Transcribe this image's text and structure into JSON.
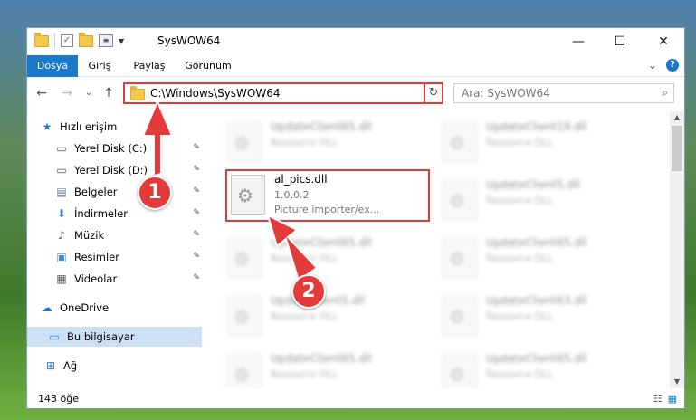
{
  "window": {
    "title": "SysWOW64",
    "controls": {
      "minimize": "—",
      "maximize": "☐",
      "close": "✕"
    }
  },
  "ribbon": {
    "tabs": [
      "Dosya",
      "Giriş",
      "Paylaş",
      "Görünüm"
    ],
    "expand_glyph": "⌄",
    "help_glyph": "?"
  },
  "nav": {
    "back": "←",
    "forward": "→",
    "recent": "⌄",
    "up": "↑",
    "address": "C:\\Windows\\SysWOW64",
    "address_chevron": "⌄",
    "refresh": "↻",
    "search_placeholder": "Ara: SysWOW64",
    "search_glyph": "⌕"
  },
  "sidebar": {
    "items": [
      {
        "label": "Hızlı erişim",
        "icon": "star-icon",
        "glyph": "★",
        "color": "#2a7fd4"
      },
      {
        "label": "Yerel Disk (C:)",
        "icon": "drive-icon",
        "glyph": "▭",
        "color": "#555"
      },
      {
        "label": "Yerel Disk (D:)",
        "icon": "drive-icon",
        "glyph": "▭",
        "color": "#555"
      },
      {
        "label": "Belgeler",
        "icon": "documents-icon",
        "glyph": "▤",
        "color": "#6a7b8c"
      },
      {
        "label": "İndirmeler",
        "icon": "download-icon",
        "glyph": "⬇",
        "color": "#2a7fd4"
      },
      {
        "label": "Müzik",
        "icon": "music-icon",
        "glyph": "♪",
        "color": "#2a7fd4"
      },
      {
        "label": "Resimler",
        "icon": "pictures-icon",
        "glyph": "▣",
        "color": "#4a8ac9"
      },
      {
        "label": "Videolar",
        "icon": "videos-icon",
        "glyph": "▦",
        "color": "#555"
      },
      {
        "label": "OneDrive",
        "icon": "cloud-icon",
        "glyph": "☁",
        "color": "#1979ca"
      },
      {
        "label": "Bu bilgisayar",
        "icon": "computer-icon",
        "glyph": "▭",
        "color": "#2a7fd4"
      },
      {
        "label": "Ağ",
        "icon": "network-icon",
        "glyph": "⊞",
        "color": "#2a7fd4"
      }
    ],
    "pin_glyph": "✎"
  },
  "files": {
    "highlighted": {
      "name": "al_pics.dll",
      "version": "1.0.0.2",
      "description": "Picture importer/ex..."
    },
    "blurred": [
      {
        "name": "UpdateClient65.dll",
        "desc": "Resource DLL"
      },
      {
        "name": "UpdateClient19.dll",
        "desc": "Resource DLL"
      },
      {
        "name": "UpdateClient5.dll",
        "desc": "Resource DLL"
      },
      {
        "name": "UpdateClient65.dll",
        "desc": "Resource DLL"
      },
      {
        "name": "UpdateClient65.dll",
        "desc": "Resource DLL"
      },
      {
        "name": "UpdateClient5.dll",
        "desc": "Resource DLL"
      },
      {
        "name": "UpdateClient63.dll",
        "desc": "Resource DLL"
      },
      {
        "name": "UpdateClient65.dll",
        "desc": "Resource DLL"
      },
      {
        "name": "UpdateClient65.dll",
        "desc": "Resource DLL"
      }
    ]
  },
  "status": {
    "count": "143 öğe"
  },
  "callouts": [
    "1",
    "2"
  ],
  "colors": {
    "accent": "#1979ca",
    "highlight": "#e53a3a"
  }
}
